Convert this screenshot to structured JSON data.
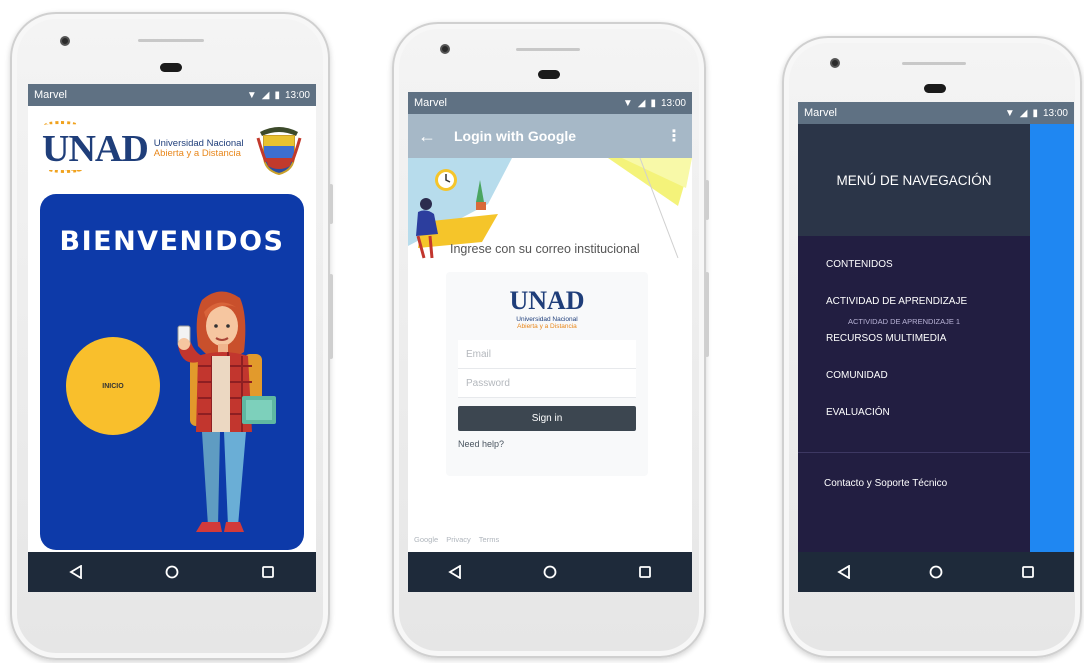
{
  "status": {
    "carrier": "Marvel",
    "time": "13:00"
  },
  "welcome": {
    "brand": {
      "mark": "UNAD",
      "line1": "Universidad Nacional",
      "line2": "Abierta y a Distancia"
    },
    "title": "BIENVENIDOS",
    "start_button": "INICIO"
  },
  "login": {
    "appbar_title": "Login with Google",
    "banner_text": "Ingrese con su correo institucional",
    "brand": {
      "mark": "UNAD",
      "line1": "Universidad Nacional",
      "line2": "Abierta y a Distancia"
    },
    "email_placeholder": "Email",
    "password_placeholder": "Password",
    "signin_label": "Sign in",
    "help_link": "Need help?",
    "footer": [
      "Google",
      "Privacy",
      "Terms"
    ]
  },
  "menu": {
    "title": "MENÚ DE NAVEGACIÓN",
    "items": [
      "CONTENIDOS",
      "ACTIVIDAD DE APRENDIZAJE",
      "RECURSOS MULTIMEDIA",
      "COMUNIDAD",
      "EVALUACIÓN"
    ],
    "sub_item": "ACTIVIDAD DE APRENDIZAJE  1",
    "contact": "Contacto  y Soporte Técnico"
  },
  "colors": {
    "welcome_card": "#0d3aa9",
    "start_button": "#f9bf2c",
    "status_bar": "#5f7183",
    "nav_bar": "#1e2a3a",
    "login_appbar": "#a6b8c7",
    "drawer": "#221e41",
    "drawer_header": "#2b3548",
    "drawer_accent": "#1f87f2"
  }
}
